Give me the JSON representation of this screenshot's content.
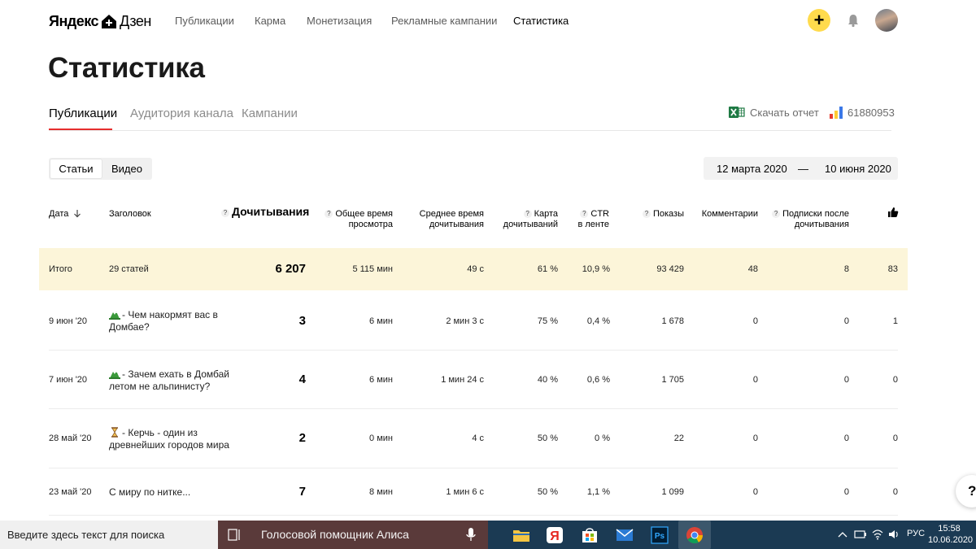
{
  "nav": {
    "logo_part1": "Яндекс",
    "logo_part2": "Дзен",
    "links": [
      "Публикации",
      "Карма",
      "Монетизация",
      "Рекламные кампании",
      "Статистика"
    ],
    "plus": "+"
  },
  "page": {
    "title": "Статистика"
  },
  "tabs": [
    "Публикации",
    "Аудитория канала",
    "Кампании"
  ],
  "actions": {
    "download": "Скачать отчет",
    "counter": "61880953"
  },
  "segments": [
    "Статьи",
    "Видео"
  ],
  "date_range": {
    "from": "12 марта 2020",
    "dash": "—",
    "to": "10 июня 2020"
  },
  "table": {
    "headers": {
      "date": "Дата",
      "title": "Заголовок",
      "reads": "Дочитывания",
      "total_time_1": "Общее время",
      "total_time_2": "просмотра",
      "avg_time_1": "Среднее время",
      "avg_time_2": "дочитывания",
      "map_1": "Карта",
      "map_2": "дочитываний",
      "ctr_1": "CTR",
      "ctr_2": "в ленте",
      "shows": "Показы",
      "comments": "Комментарии",
      "subs_1": "Подписки после",
      "subs_2": "дочитывания"
    },
    "totals": {
      "label": "Итого",
      "title": "29 статей",
      "reads": "6 207",
      "total_time": "5 115 мин",
      "avg_time": "49 с",
      "map": "61 %",
      "ctr": "10,9 %",
      "shows": "93 429",
      "comments": "48",
      "subs": "8",
      "likes": "83"
    },
    "rows": [
      {
        "date": "9 июн '20",
        "title_1": "- Чем накормят вас в",
        "title_2": "Домбае?",
        "reads": "3",
        "total_time": "6 мин",
        "avg_time": "2 мин 3 с",
        "map": "75 %",
        "ctr": "0,4 %",
        "shows": "1 678",
        "comments": "0",
        "subs": "0",
        "likes": "1"
      },
      {
        "date": "7 июн '20",
        "title_1": "- Зачем ехать в Домбай",
        "title_2": "летом не альпинисту?",
        "reads": "4",
        "total_time": "6 мин",
        "avg_time": "1 мин 24 с",
        "map": "40 %",
        "ctr": "0,6 %",
        "shows": "1 705",
        "comments": "0",
        "subs": "0",
        "likes": "0"
      },
      {
        "date": "28 май '20",
        "title_1": "- Керчь - один из",
        "title_2": "древнейших городов мира",
        "reads": "2",
        "total_time": "0 мин",
        "avg_time": "4 с",
        "map": "50 %",
        "ctr": "0 %",
        "shows": "22",
        "comments": "0",
        "subs": "0",
        "likes": "0"
      },
      {
        "date": "23 май '20",
        "title_1": "С миру по нитке...",
        "title_2": "",
        "reads": "7",
        "total_time": "8 мин",
        "avg_time": "1 мин 6 с",
        "map": "50 %",
        "ctr": "1,1 %",
        "shows": "1 099",
        "comments": "0",
        "subs": "0",
        "likes": "0"
      }
    ]
  },
  "help": "?",
  "taskbar": {
    "search_placeholder": "Введите здесь текст для поиска",
    "alisa": "Голосовой помощник Алиса",
    "lang": "РУС",
    "time": "15:58",
    "date": "10.06.2020"
  }
}
